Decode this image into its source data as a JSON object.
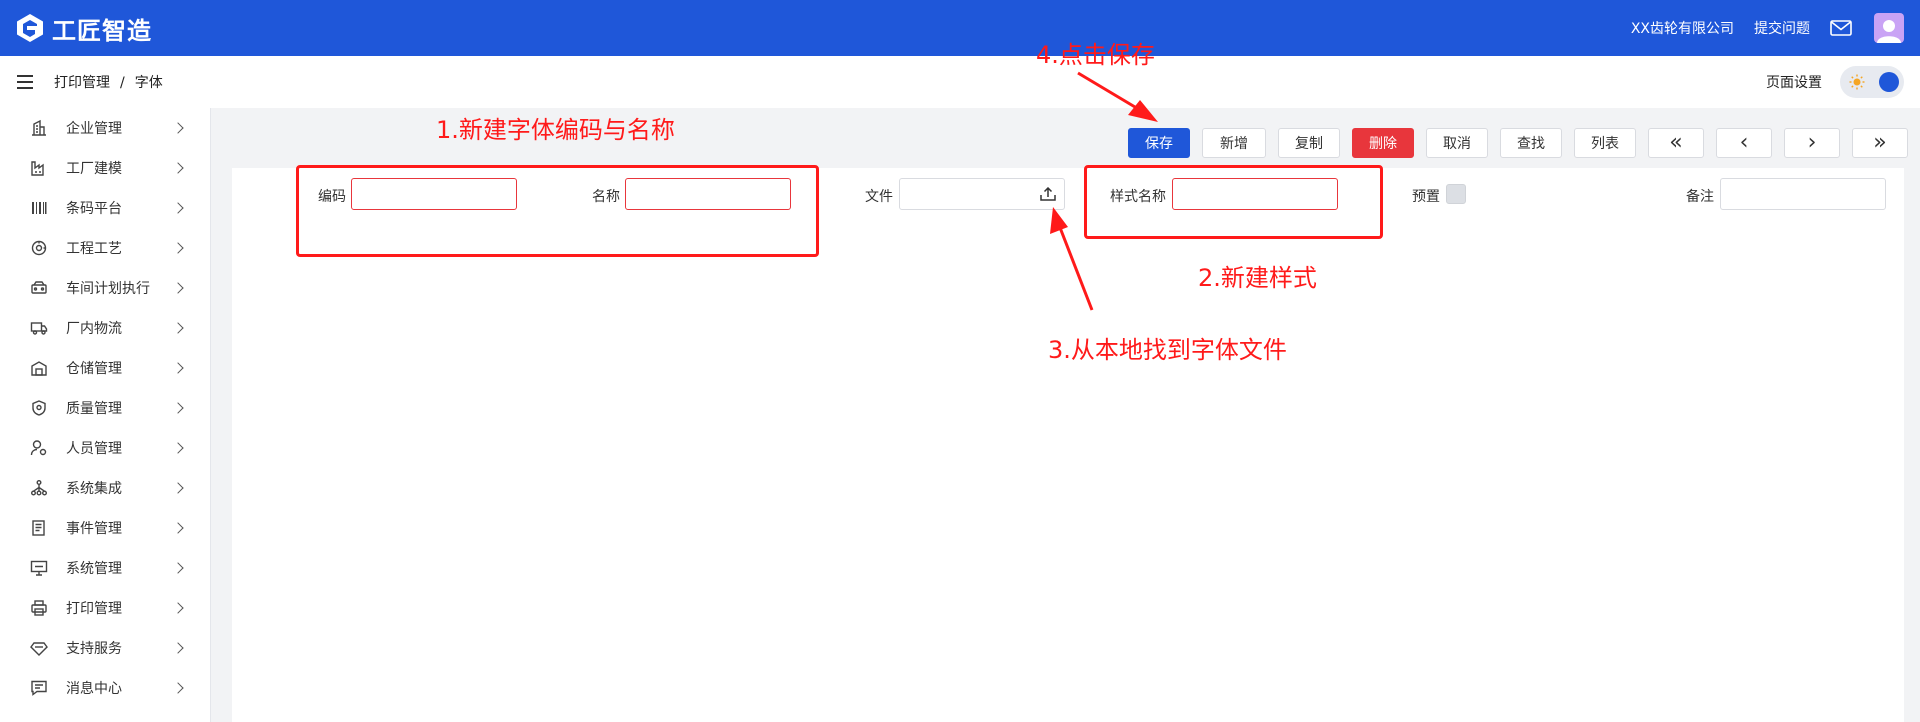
{
  "header": {
    "app_name": "工匠智造",
    "company": "XX齿轮有限公司",
    "submit_issue": "提交问题",
    "brand_color": "#1f57d9"
  },
  "breadcrumb": {
    "parent": "打印管理",
    "separator": "/",
    "current": "字体"
  },
  "page_settings": "页面设置",
  "sidebar": {
    "items": [
      {
        "label": "企业管理",
        "icon": "building-icon"
      },
      {
        "label": "工厂建模",
        "icon": "factory-icon"
      },
      {
        "label": "条码平台",
        "icon": "barcode-icon"
      },
      {
        "label": "工程工艺",
        "icon": "process-icon"
      },
      {
        "label": "车间计划执行",
        "icon": "workshop-icon"
      },
      {
        "label": "厂内物流",
        "icon": "truck-icon"
      },
      {
        "label": "仓储管理",
        "icon": "warehouse-icon"
      },
      {
        "label": "质量管理",
        "icon": "shield-icon"
      },
      {
        "label": "人员管理",
        "icon": "user-gear-icon"
      },
      {
        "label": "系统集成",
        "icon": "network-icon"
      },
      {
        "label": "事件管理",
        "icon": "document-icon"
      },
      {
        "label": "系统管理",
        "icon": "monitor-icon"
      },
      {
        "label": "打印管理",
        "icon": "printer-icon"
      },
      {
        "label": "支持服务",
        "icon": "diamond-icon"
      },
      {
        "label": "消息中心",
        "icon": "message-icon"
      }
    ]
  },
  "toolbar": {
    "save": "保存",
    "add": "新增",
    "copy": "复制",
    "delete": "删除",
    "cancel": "取消",
    "find": "查找",
    "list": "列表",
    "first": "«",
    "prev": "‹",
    "next": "›",
    "last": "»"
  },
  "form": {
    "code_label": "编码",
    "name_label": "名称",
    "file_label": "文件",
    "style_name_label": "样式名称",
    "preset_label": "预置",
    "remark_label": "备注",
    "code_value": "",
    "name_value": "",
    "file_value": "",
    "style_name_value": "",
    "remark_value": ""
  },
  "annotations": {
    "step1": "1.新建字体编码与名称",
    "step2": "2.新建样式",
    "step3": "3.从本地找到字体文件",
    "step4": "4.点击保存",
    "color": "#ff1a1a"
  }
}
